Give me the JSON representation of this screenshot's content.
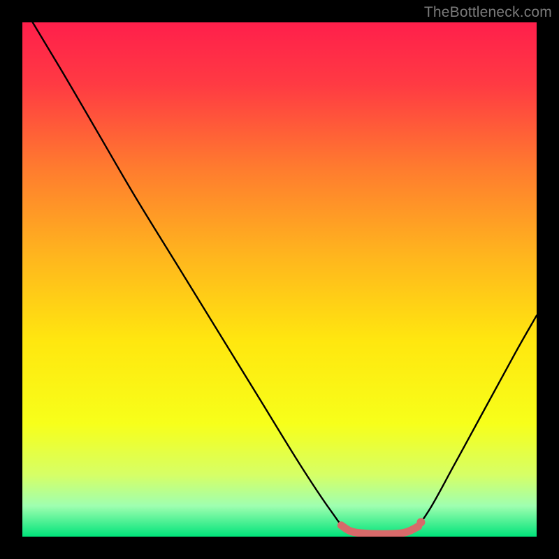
{
  "watermark": "TheBottleneck.com",
  "chart_data": {
    "type": "line",
    "title": "",
    "xlabel": "",
    "ylabel": "",
    "xlim": [
      0,
      100
    ],
    "ylim": [
      0,
      100
    ],
    "grid": false,
    "legend": false,
    "background_gradient": {
      "stops": [
        {
          "offset": 0.0,
          "color": "#ff1f4b"
        },
        {
          "offset": 0.12,
          "color": "#ff3a43"
        },
        {
          "offset": 0.28,
          "color": "#ff7a2f"
        },
        {
          "offset": 0.45,
          "color": "#ffb41e"
        },
        {
          "offset": 0.62,
          "color": "#ffe70f"
        },
        {
          "offset": 0.78,
          "color": "#f7ff1a"
        },
        {
          "offset": 0.88,
          "color": "#d6ff66"
        },
        {
          "offset": 0.94,
          "color": "#9fffb0"
        },
        {
          "offset": 1.0,
          "color": "#00e37a"
        }
      ]
    },
    "series": [
      {
        "name": "bottleneck-curve",
        "color": "#000000",
        "points": [
          {
            "x": 2,
            "y": 100
          },
          {
            "x": 8,
            "y": 90
          },
          {
            "x": 15,
            "y": 78
          },
          {
            "x": 22,
            "y": 66
          },
          {
            "x": 30,
            "y": 53
          },
          {
            "x": 38,
            "y": 40
          },
          {
            "x": 46,
            "y": 27
          },
          {
            "x": 54,
            "y": 14
          },
          {
            "x": 60,
            "y": 5
          },
          {
            "x": 63,
            "y": 1.5
          },
          {
            "x": 67,
            "y": 0.5
          },
          {
            "x": 72,
            "y": 0.5
          },
          {
            "x": 76,
            "y": 1.5
          },
          {
            "x": 79,
            "y": 5
          },
          {
            "x": 84,
            "y": 14
          },
          {
            "x": 90,
            "y": 25
          },
          {
            "x": 96,
            "y": 36
          },
          {
            "x": 100,
            "y": 43
          }
        ]
      },
      {
        "name": "optimal-zone",
        "color": "#d86a6a",
        "points": [
          {
            "x": 62,
            "y": 2.2
          },
          {
            "x": 64,
            "y": 1.0
          },
          {
            "x": 67,
            "y": 0.6
          },
          {
            "x": 70,
            "y": 0.5
          },
          {
            "x": 73,
            "y": 0.6
          },
          {
            "x": 75,
            "y": 1.0
          },
          {
            "x": 77,
            "y": 2.0
          }
        ]
      }
    ],
    "markers": [
      {
        "name": "highlight-dot",
        "x": 77.5,
        "y": 2.8,
        "color": "#d86a6a",
        "r": 6
      }
    ]
  }
}
